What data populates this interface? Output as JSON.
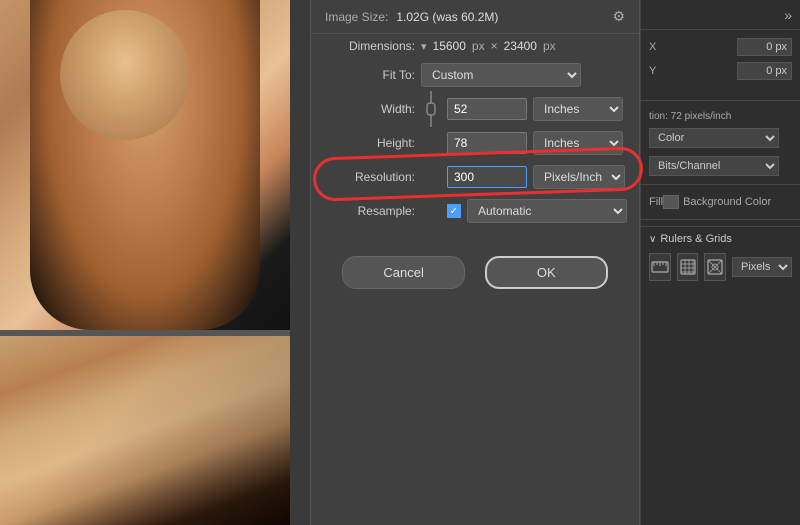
{
  "dialog": {
    "title_label": "Image Size:",
    "title_value": "1.02G (was 60.2M)",
    "gear_icon": "⚙",
    "dimensions_label": "Dimensions:",
    "dimensions_arrow": "▾",
    "dimensions_width": "15600",
    "dimensions_width_unit": "px",
    "dimensions_x": "×",
    "dimensions_height": "23400",
    "dimensions_height_unit": "px",
    "fit_label": "Fit To:",
    "fit_value": "Custom",
    "fit_icon": "▾",
    "width_label": "Width:",
    "width_value": "52",
    "width_unit": "Inches",
    "height_label": "Height:",
    "height_value": "78",
    "height_unit": "Inches",
    "resolution_label": "Resolution:",
    "resolution_value": "300",
    "resolution_unit": "Pixels/Inch",
    "resample_label": "Resample:",
    "resample_value": "Automatic",
    "resample_icon": "▾",
    "cancel_label": "Cancel",
    "ok_label": "OK",
    "chain_icon": "🔗"
  },
  "right_panel": {
    "expand_icon": "»",
    "x_label": "X",
    "x_placeholder": "0 px",
    "y_label": "Y",
    "y_placeholder": "0 px",
    "resolution_text": "tion: 72 pixels/inch",
    "color_label": "Color",
    "bits_label": "Bits/Channel",
    "fill_label": "Fill",
    "bg_color_label": "Background Color",
    "rulers_label": "Rulers & Grids",
    "collapse_icon": "∨",
    "pixels_label": "Pixels",
    "ruler_icon1": "📏",
    "ruler_icon2": "⊞",
    "ruler_icon3": "⊠"
  }
}
